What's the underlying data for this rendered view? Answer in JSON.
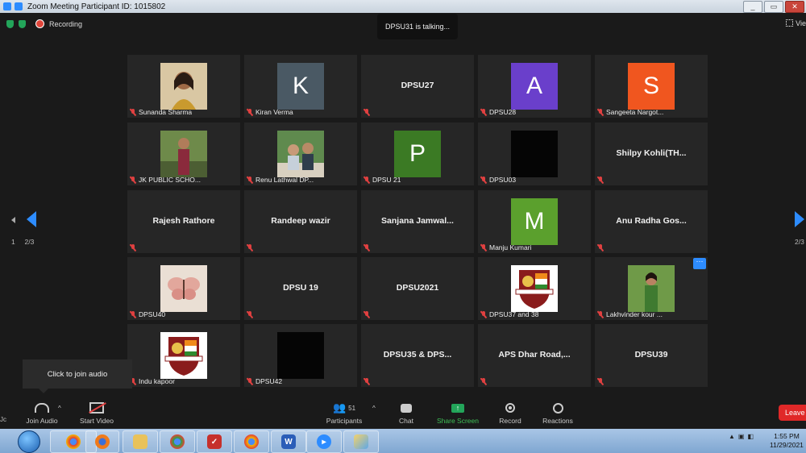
{
  "window": {
    "title": "Zoom Meeting Participant ID: 1015802"
  },
  "top": {
    "recording_label": "Recording",
    "talking_text": "DPSU31 is talking...",
    "view_label": "Vie"
  },
  "nav": {
    "left_page": "1",
    "page_indicator": "2/3",
    "right_page_indicator": "2/3"
  },
  "tiles": [
    {
      "name": "Sunanda Sharma",
      "kind": "photo",
      "photo": "woman-portrait"
    },
    {
      "name": "Kiran Verma",
      "kind": "avatar",
      "letter": "K",
      "color": "#4a5964"
    },
    {
      "name": "DPSU27",
      "kind": "text"
    },
    {
      "name": "DPSU28",
      "kind": "avatar",
      "letter": "A",
      "color": "#6a3fcb"
    },
    {
      "name": "Sangeeta Nargot...",
      "kind": "avatar",
      "letter": "S",
      "color": "#f0561f"
    },
    {
      "name": "JK PUBLIC SCHO...",
      "kind": "photo",
      "photo": "outdoor-portrait"
    },
    {
      "name": "Renu Lathwal DP...",
      "kind": "photo",
      "photo": "children-photo"
    },
    {
      "name": "DPSU 21",
      "kind": "avatar",
      "letter": "P",
      "color": "#3b7a24"
    },
    {
      "name": "DPSU03",
      "kind": "photo",
      "photo": "black-video"
    },
    {
      "name": "Shilpy  Kohli(TH...",
      "kind": "text"
    },
    {
      "name": "Rajesh Rathore",
      "kind": "text"
    },
    {
      "name": "Randeep  wazir",
      "kind": "text"
    },
    {
      "name": "Sanjana  Jamwal...",
      "kind": "text"
    },
    {
      "name": "Manju Kumari",
      "kind": "avatar",
      "letter": "M",
      "color": "#5ba02d"
    },
    {
      "name": "Anu Radha Gos...",
      "kind": "text"
    },
    {
      "name": "DPSU40",
      "kind": "photo",
      "photo": "butterfly"
    },
    {
      "name": "DPSU 19",
      "kind": "text"
    },
    {
      "name": "DPSU2021",
      "kind": "text"
    },
    {
      "name": "DPSU37 and 38",
      "kind": "photo",
      "photo": "school-logo"
    },
    {
      "name": "Lakhvinder kour ...",
      "kind": "photo",
      "photo": "woman-garden"
    },
    {
      "name": "Indu kapoor",
      "kind": "photo",
      "photo": "school-logo"
    },
    {
      "name": "DPSU42",
      "kind": "photo",
      "photo": "black-video"
    },
    {
      "name": "DPSU35 & DPS...",
      "kind": "text"
    },
    {
      "name": "APS Dhar Road,...",
      "kind": "text"
    },
    {
      "name": "DPSU39",
      "kind": "text"
    }
  ],
  "tooltip": {
    "text": "Click to join audio"
  },
  "toolbar": {
    "join_audio": "Join Audio",
    "start_video": "Start Video",
    "participants": "Participants",
    "participants_count": "51",
    "chat": "Chat",
    "share_screen": "Share Screen",
    "record": "Record",
    "reactions": "Reactions",
    "leave": "Leave",
    "left_cut": "Jc"
  },
  "taskbar": {
    "time": "1:55 PM",
    "date": "11/29/2021"
  },
  "colors": {
    "accent": "#2d8cff",
    "share_green": "#3fc157",
    "leave_red": "#e02828"
  }
}
